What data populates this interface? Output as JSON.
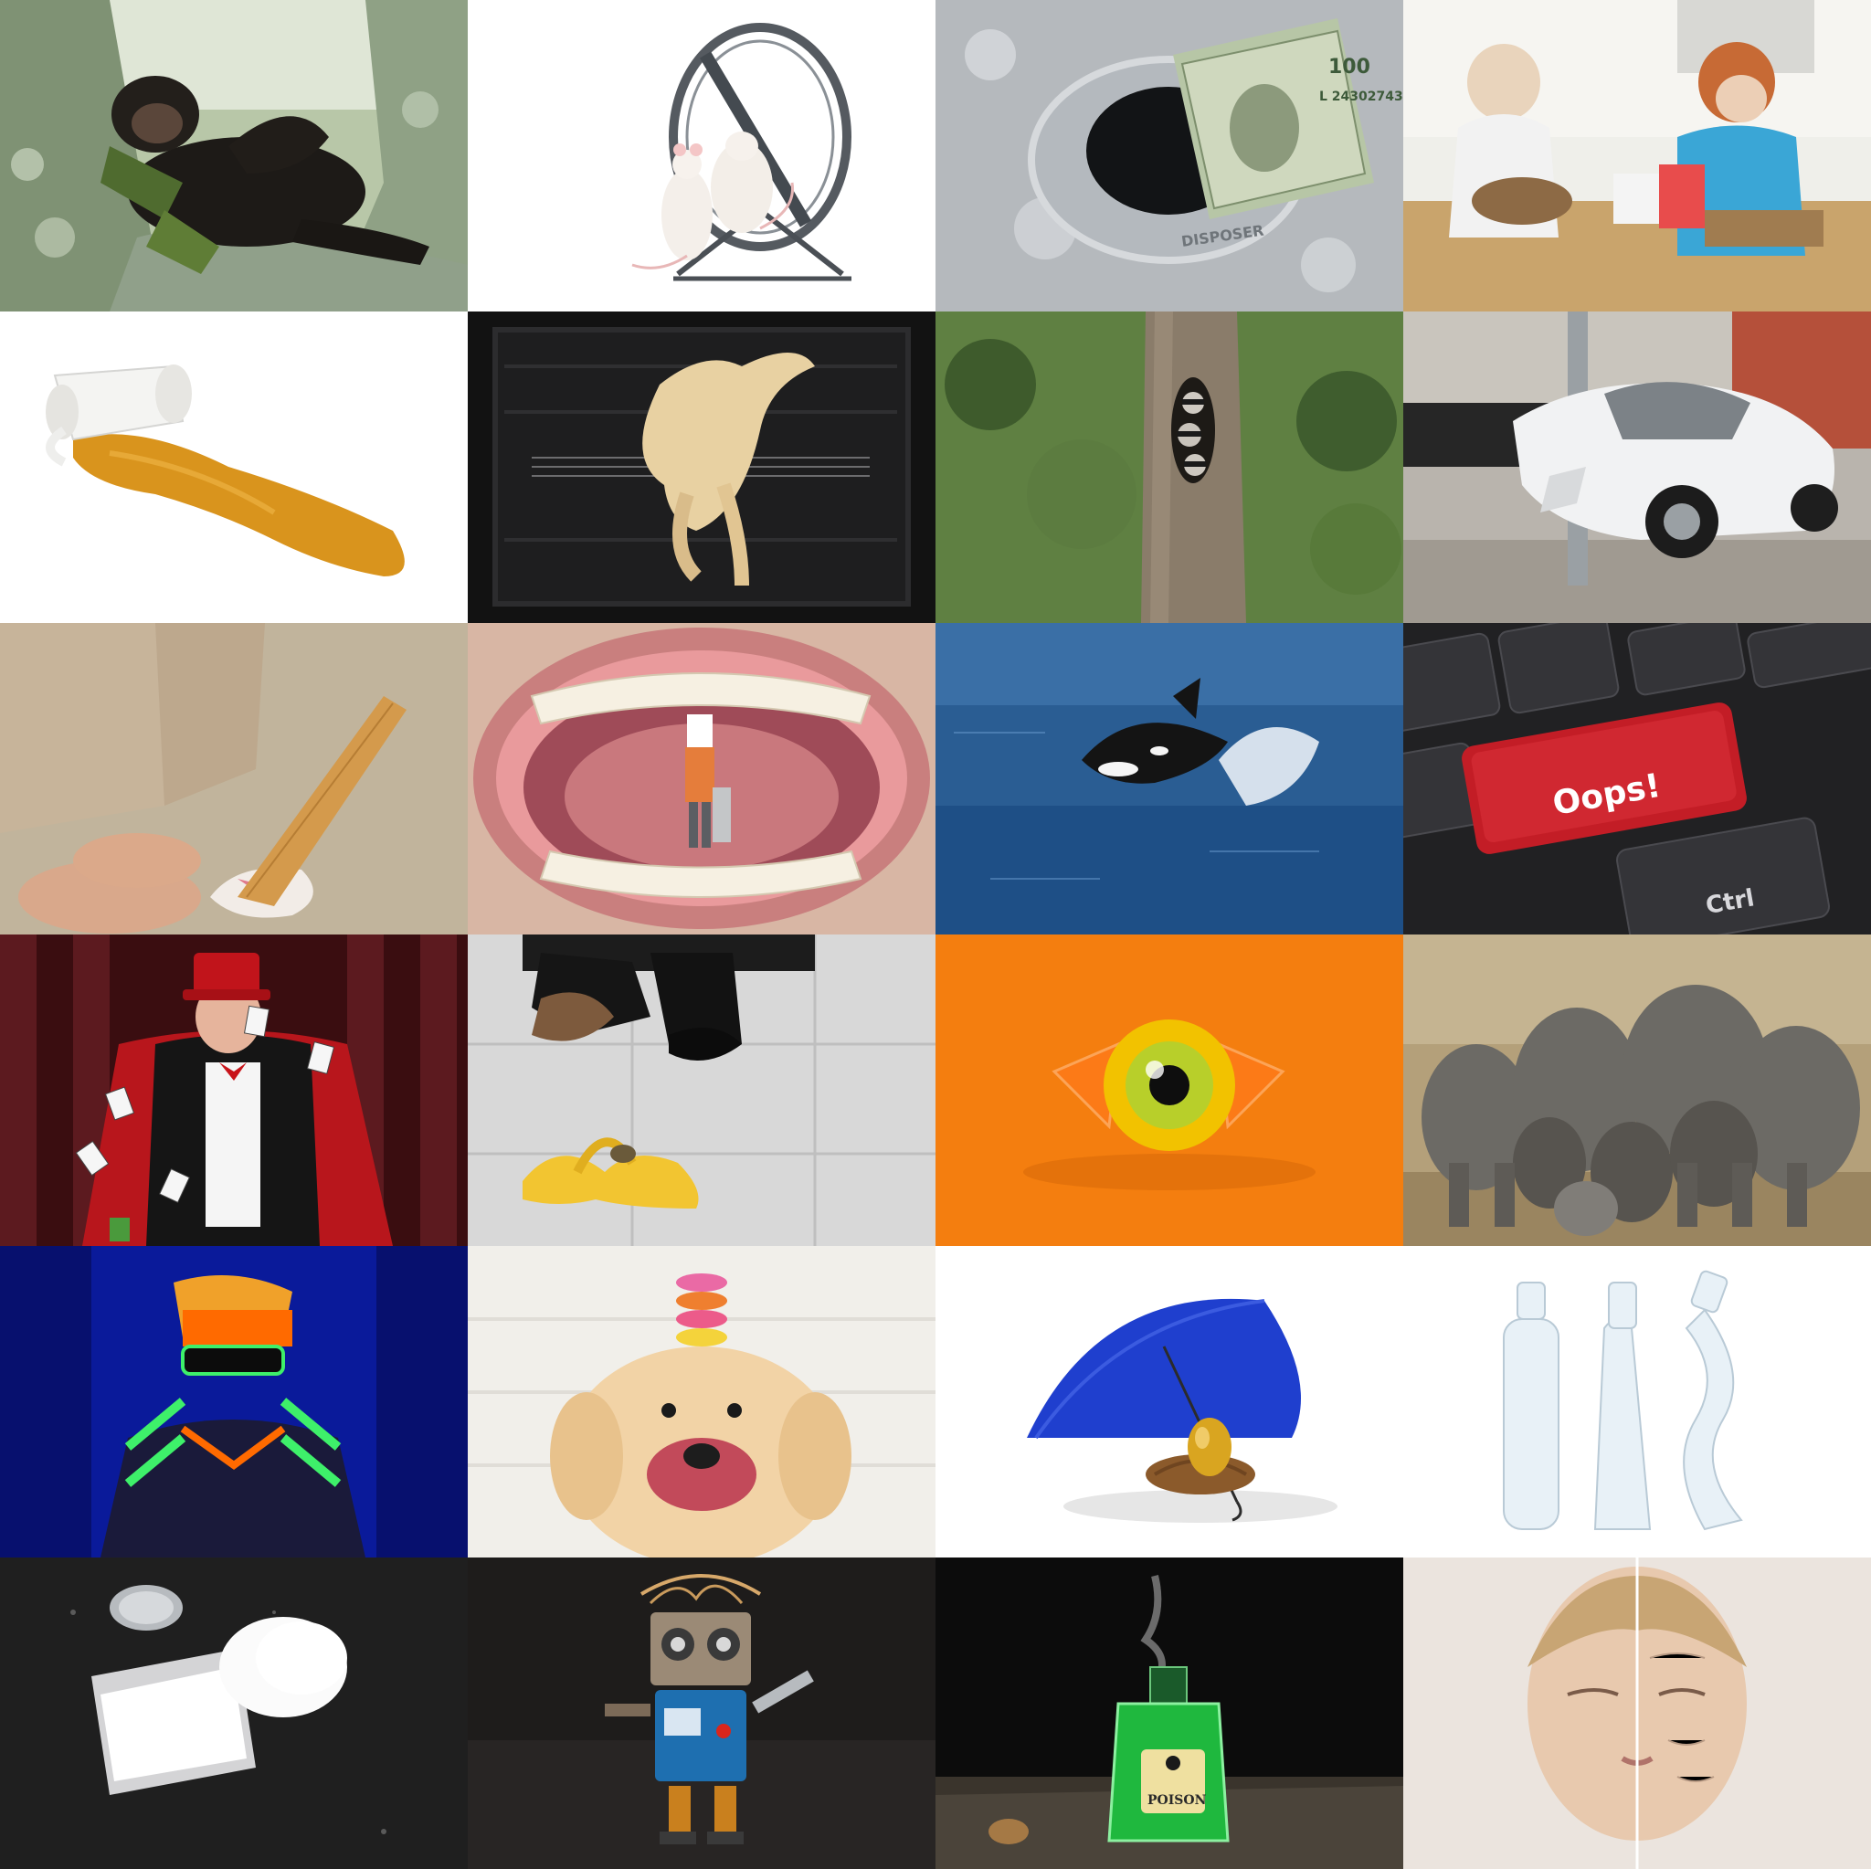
{
  "grid": {
    "columns": 4,
    "rows": 6
  },
  "tiles": [
    {
      "id": "chimpanzee-resting-in-tree"
    },
    {
      "id": "mice-on-hamster-wheel"
    },
    {
      "id": "dollar-bills-down-drain",
      "drain_text": "DISPOSER",
      "bill_serial": "L 24302743",
      "bill_seal": "100"
    },
    {
      "id": "kids-messy-kitchen"
    },
    {
      "id": "spilled-coffee-cup"
    },
    {
      "id": "raw-chicken-in-oven"
    },
    {
      "id": "raccoons-in-tree-hollow"
    },
    {
      "id": "car-crashed-into-pole"
    },
    {
      "id": "dropped-ice-cream-cone"
    },
    {
      "id": "miniature-worker-in-mouth"
    },
    {
      "id": "orca-jumping"
    },
    {
      "id": "oops-keyboard-key",
      "oops_key": "Oops!",
      "ctrl_key": "Ctrl"
    },
    {
      "id": "magician-with-cards"
    },
    {
      "id": "banana-peel-slip"
    },
    {
      "id": "eyeball-candy"
    },
    {
      "id": "elephant-herd"
    },
    {
      "id": "neon-glow-person"
    },
    {
      "id": "dog-with-macarons"
    },
    {
      "id": "umbrella-golden-egg"
    },
    {
      "id": "crushed-plastic-bottles"
    },
    {
      "id": "spilled-salt-shaker"
    },
    {
      "id": "toy-robot-with-wrench"
    },
    {
      "id": "poison-bottle",
      "label": "POISON"
    },
    {
      "id": "aging-face-split"
    }
  ]
}
